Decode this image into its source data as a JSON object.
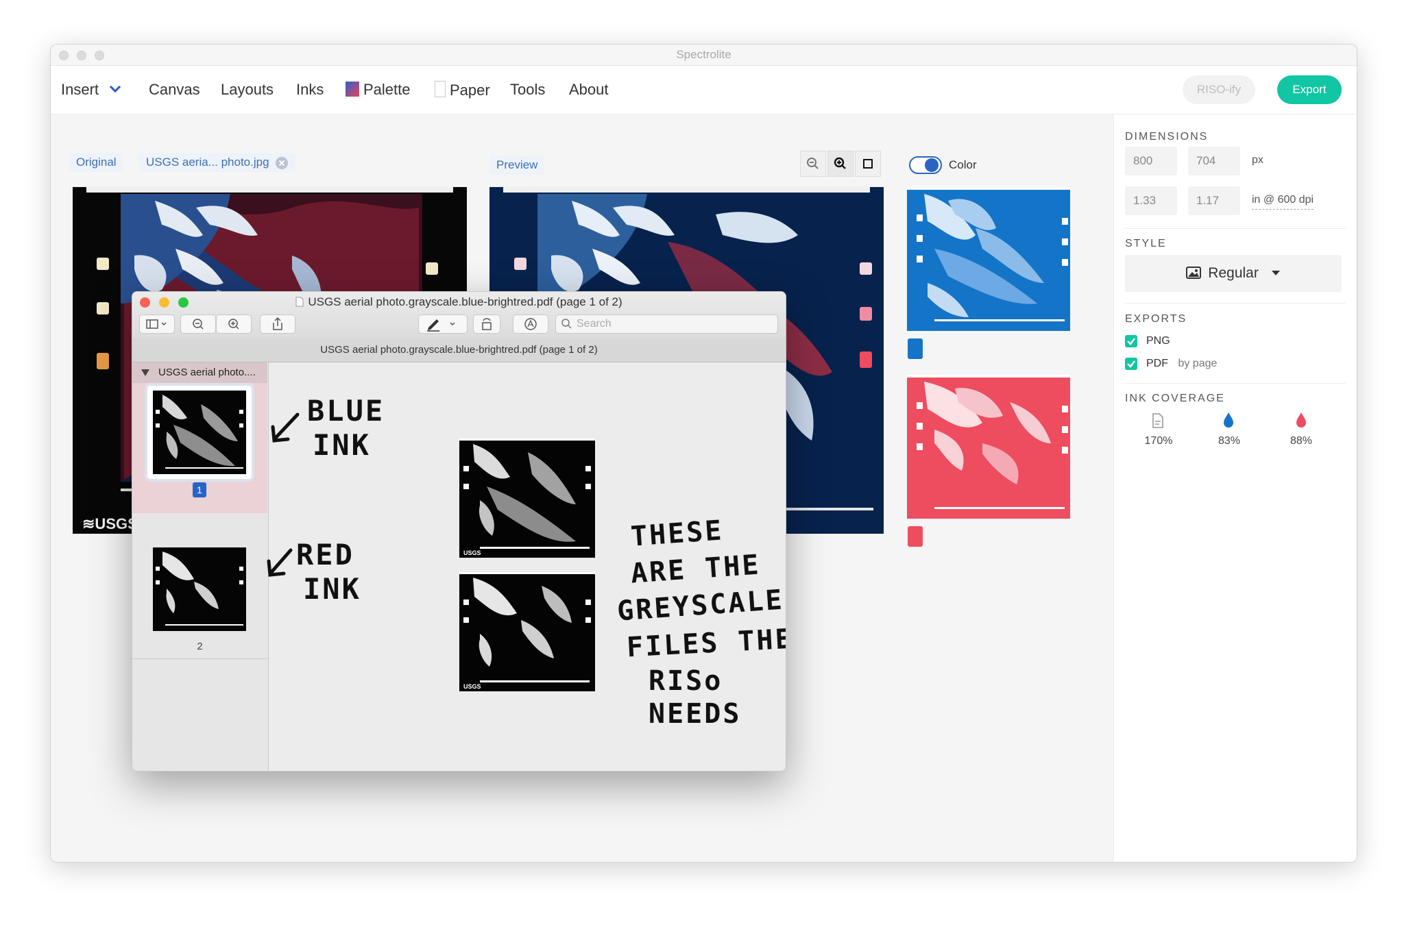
{
  "app": {
    "title": "Spectrolite",
    "menu": {
      "insert": "Insert",
      "canvas": "Canvas",
      "layouts": "Layouts",
      "inks": "Inks",
      "palette": "Palette",
      "paper": "Paper",
      "tools": "Tools",
      "about": "About"
    },
    "riso_label": "RISO-ify",
    "export_label": "Export"
  },
  "workspace": {
    "original_label": "Original",
    "file_chip": "USGS aeria... photo.jpg",
    "preview_label": "Preview",
    "color_toggle_label": "Color",
    "color_toggle_on": true,
    "ink_colors": {
      "blue": "#1474c8",
      "red": "#ee4c5f",
      "accent": "#12c5a3"
    }
  },
  "sidebar": {
    "dimensions_label": "DIMENSIONS",
    "width_px": "800",
    "height_px": "704",
    "px_unit": "px",
    "width_in": "1.33",
    "height_in": "1.17",
    "in_unit": "in @ 600 dpi",
    "style_label": "STYLE",
    "style_value": "Regular",
    "exports_label": "EXPORTS",
    "export_png": "PNG",
    "export_pdf": "PDF",
    "export_pdf_note": "by page",
    "ink_coverage_label": "INK COVERAGE",
    "coverage_total": "170%",
    "coverage_blue": "83%",
    "coverage_red": "88%"
  },
  "preview_window": {
    "title": "USGS aerial photo.grayscale.blue-brightred.pdf (page 1 of 2)",
    "subtitle": "USGS aerial photo.grayscale.blue-brightred.pdf (page 1 of 2)",
    "search_placeholder": "Search",
    "sidebar_doc": "USGS aerial photo....",
    "page1_label": "1",
    "page2_label": "2",
    "note_blue_1": "BLUE",
    "note_blue_2": "INK",
    "note_red_1": "RED",
    "note_red_2": "INK",
    "note_main_1": "THESE",
    "note_main_2": "ARE THE",
    "note_main_3": "GREYSCALE",
    "note_main_4": "FILES THE",
    "note_main_5": "RISo",
    "note_main_6": "NEEDS",
    "logo_text": "USGS"
  }
}
